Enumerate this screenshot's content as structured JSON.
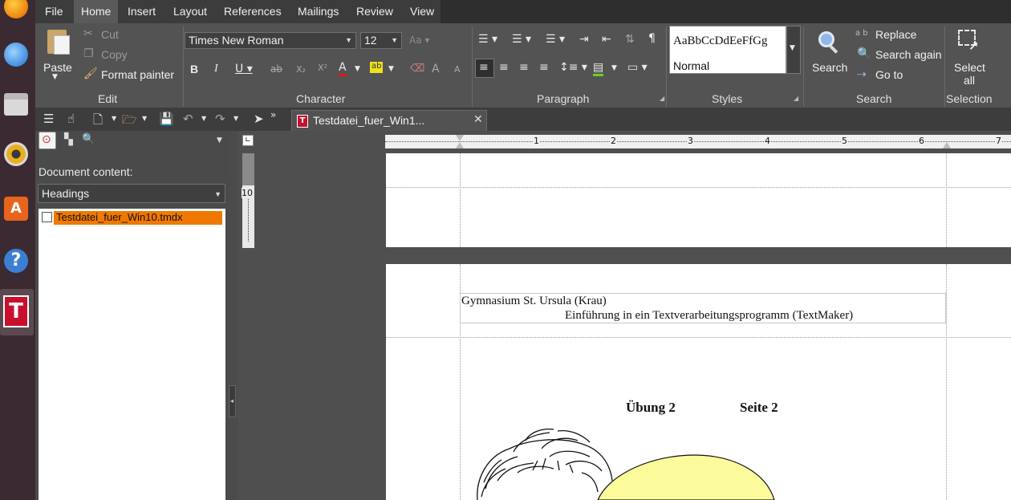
{
  "menu": [
    "File",
    "Home",
    "Insert",
    "Layout",
    "References",
    "Mailings",
    "Review",
    "View"
  ],
  "ribbon": {
    "edit": {
      "paste": "Paste",
      "cut": "Cut",
      "copy": "Copy",
      "format_painter": "Format painter",
      "label": "Edit"
    },
    "character": {
      "font_name": "Times New Roman",
      "font_size": "12",
      "label": "Character"
    },
    "paragraph": {
      "label": "Paragraph"
    },
    "styles": {
      "preview": "AaBbCcDdEeFfGg",
      "current": "Normal",
      "label": "Styles"
    },
    "search": {
      "search": "Search",
      "replace": "Replace",
      "search_again": "Search again",
      "go_to": "Go to",
      "label": "Search"
    },
    "selection": {
      "select": "Select",
      "all": "all",
      "label": "Selection"
    }
  },
  "tab": {
    "title": "Testdatei_fuer_Win1..."
  },
  "sidebar": {
    "heading": "Document content:",
    "mode": "Headings",
    "tree_item": "Testdatei_fuer_Win10.tmdx"
  },
  "ruler": {
    "h_labels": [
      "1",
      "2",
      "3",
      "4",
      "5",
      "6",
      "7"
    ],
    "v_label": "10"
  },
  "document": {
    "header_line1": "Gymnasium St. Ursula (Krau)",
    "header_line2": "Einführung in ein Textverarbeitungsprogramm (TextMaker)",
    "exercise": "Übung 2",
    "page": "Seite 2"
  },
  "colors": {
    "accent_orange": "#f07800",
    "highlight_yellow": "#fbfb9c"
  }
}
